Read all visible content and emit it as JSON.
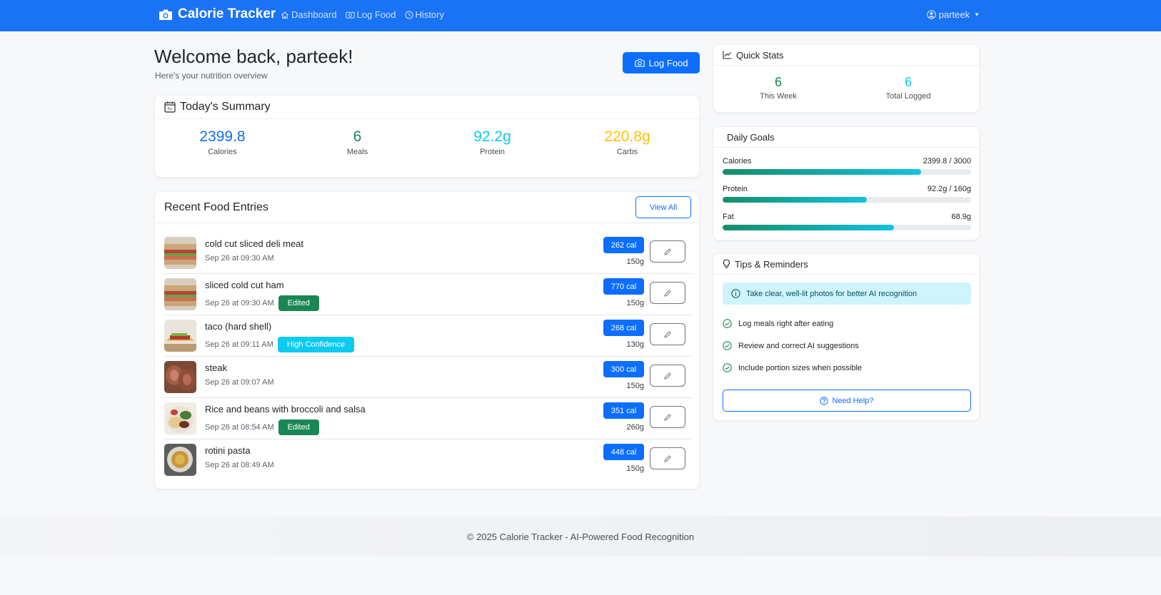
{
  "nav": {
    "brand": "Calorie Tracker",
    "links": [
      "Dashboard",
      "Log Food",
      "History"
    ],
    "user": "parteek"
  },
  "welcome": {
    "title": "Welcome back, parteek!",
    "subtitle": "Here's your nutrition overview",
    "log_button": "Log Food"
  },
  "summary": {
    "title": "Today's Summary",
    "calendar_text": "Fri",
    "stats": [
      {
        "value": "2399.8",
        "label": "Calories",
        "color": "#0d6efd"
      },
      {
        "value": "6",
        "label": "Meals",
        "color": "#198754"
      },
      {
        "value": "92.2g",
        "label": "Protein",
        "color": "#0dcaf0"
      },
      {
        "value": "220.8g",
        "label": "Carbs",
        "color": "#ffc107"
      }
    ]
  },
  "recent": {
    "title": "Recent Food Entries",
    "view_all": "View All",
    "entries": [
      {
        "name": "cold cut sliced deli meat",
        "time": "Sep 26 at 09:30 AM",
        "badge": "",
        "calories": "262 cal",
        "weight": "150g",
        "thumb": "sandwich"
      },
      {
        "name": "sliced cold cut ham",
        "time": "Sep 26 at 09:30 AM",
        "badge": "Edited",
        "calories": "770 cal",
        "weight": "150g",
        "thumb": "sandwich"
      },
      {
        "name": "taco (hard shell)",
        "time": "Sep 26 at 09:11 AM",
        "badge": "High Confidence",
        "calories": "268 cal",
        "weight": "130g",
        "thumb": "taco"
      },
      {
        "name": "steak",
        "time": "Sep 26 at 09:07 AM",
        "badge": "",
        "calories": "300 cal",
        "weight": "150g",
        "thumb": "steak"
      },
      {
        "name": "Rice and beans with broccoli and salsa",
        "time": "Sep 26 at 08:54 AM",
        "badge": "Edited",
        "calories": "351 cal",
        "weight": "260g",
        "thumb": "rice"
      },
      {
        "name": "rotini pasta",
        "time": "Sep 26 at 08:49 AM",
        "badge": "",
        "calories": "448 cal",
        "weight": "150g",
        "thumb": "pasta"
      }
    ]
  },
  "quick_stats": {
    "title": "Quick Stats",
    "items": [
      {
        "value": "6",
        "label": "This Week",
        "color": "#198754"
      },
      {
        "value": "6",
        "label": "Total Logged",
        "color": "#0dcaf0"
      }
    ]
  },
  "goals": {
    "title": "Daily Goals",
    "items": [
      {
        "label": "Calories",
        "value": "2399.8 / 3000",
        "progress_pct": 80
      },
      {
        "label": "Protein",
        "value": "92.2g / 160g",
        "progress_pct": 58
      },
      {
        "label": "Fat",
        "value": "68.9g",
        "progress_pct": 69
      }
    ]
  },
  "tips": {
    "title": "Tips & Reminders",
    "alert": "Take clear, well-lit photos for better AI recognition",
    "items": [
      "Log meals right after eating",
      "Review and correct AI suggestions",
      "Include portion sizes when possible"
    ],
    "help_button": "Need Help?"
  },
  "footer": "© 2025 Calorie Tracker - AI-Powered Food Recognition"
}
